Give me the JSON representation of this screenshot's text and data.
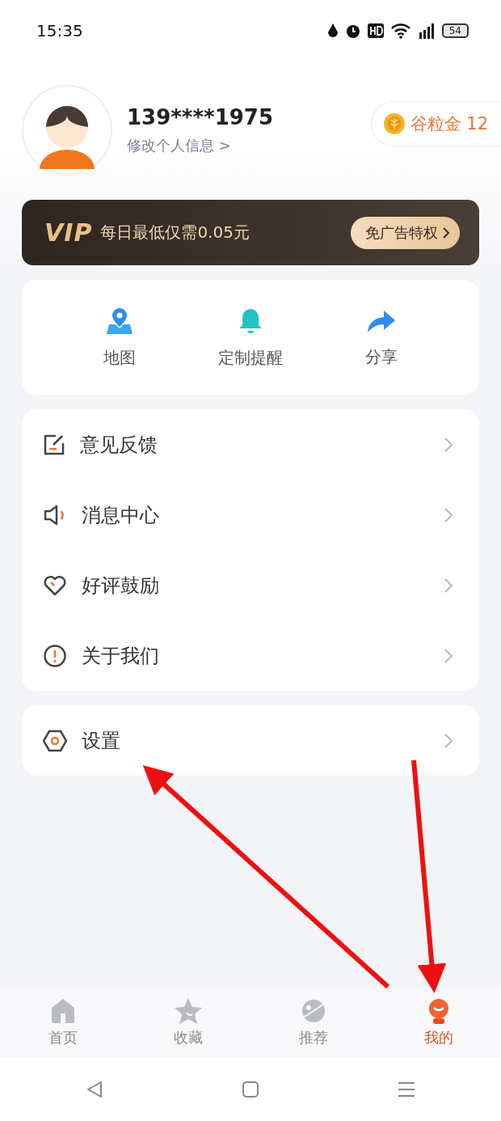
{
  "status_bar": {
    "time": "15:35",
    "battery": "54"
  },
  "profile": {
    "phone": "139****1975",
    "edit_link": "修改个人信息 >",
    "coins": "谷粒金 12"
  },
  "vip_banner": {
    "badge": "VIP",
    "text": "每日最低仅需0.05元",
    "button": "免广告特权"
  },
  "quick_actions": [
    {
      "label": "地图"
    },
    {
      "label": "定制提醒"
    },
    {
      "label": "分享"
    }
  ],
  "menu": [
    {
      "label": "意见反馈"
    },
    {
      "label": "消息中心"
    },
    {
      "label": "好评鼓励"
    },
    {
      "label": "关于我们"
    }
  ],
  "settings": {
    "label": "设置"
  },
  "tab_bar": [
    {
      "label": "首页",
      "selected": false
    },
    {
      "label": "收藏",
      "selected": false
    },
    {
      "label": "推荐",
      "selected": false
    },
    {
      "label": "我的",
      "selected": true
    }
  ]
}
